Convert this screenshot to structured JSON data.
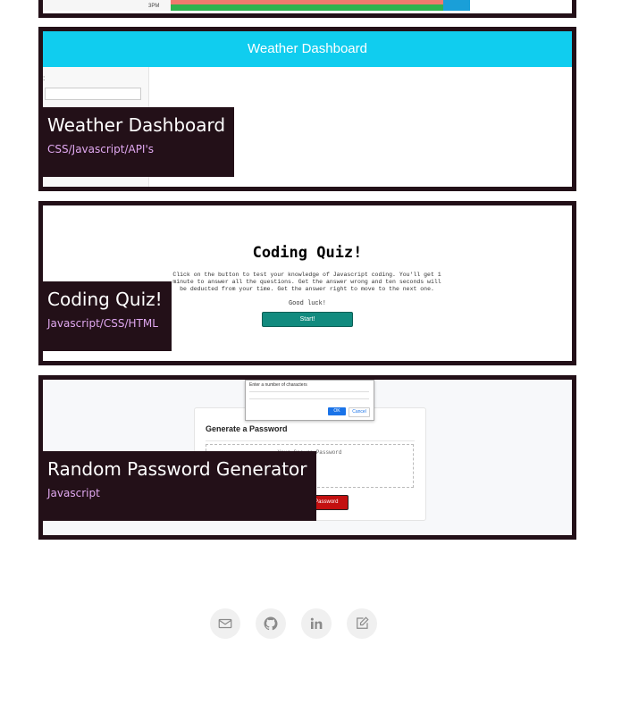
{
  "projects": [
    {
      "title": "",
      "tech": "",
      "preview": {
        "time_label": "3PM"
      }
    },
    {
      "title": "Weather Dashboard",
      "tech": "CSS/Javascript/API's",
      "preview": {
        "header": "Weather Dashboard"
      }
    },
    {
      "title": "Coding Quiz!",
      "tech": "Javascript/CSS/HTML",
      "preview": {
        "heading": "Coding Quiz!",
        "description": "Click on the button to test your knowledge of Javascript coding. You'll get 1 minute to answer all the questions. Get the answer wrong and ten seconds will be deducted from your time. Get the answer right to move to the next one.",
        "good_luck": "Good luck!",
        "start_label": "Start!"
      }
    },
    {
      "title": "Random Password Generator",
      "tech": "Javascript",
      "preview": {
        "dialog_text": "Enter a number of characters",
        "ok_label": "OK",
        "cancel_label": "Cancel",
        "heading": "Generate a Password",
        "placeholder": "Your Secure Password",
        "button_label": "Generate Password"
      }
    }
  ],
  "footer": {
    "icons": [
      "mail-icon",
      "github-icon",
      "linkedin-icon",
      "resume-icon"
    ],
    "icon_color": "#8a8a8a"
  },
  "colors": {
    "card_border": "#231018",
    "tech_text": "#e0a8f0",
    "weather_header": "#10cdef"
  }
}
